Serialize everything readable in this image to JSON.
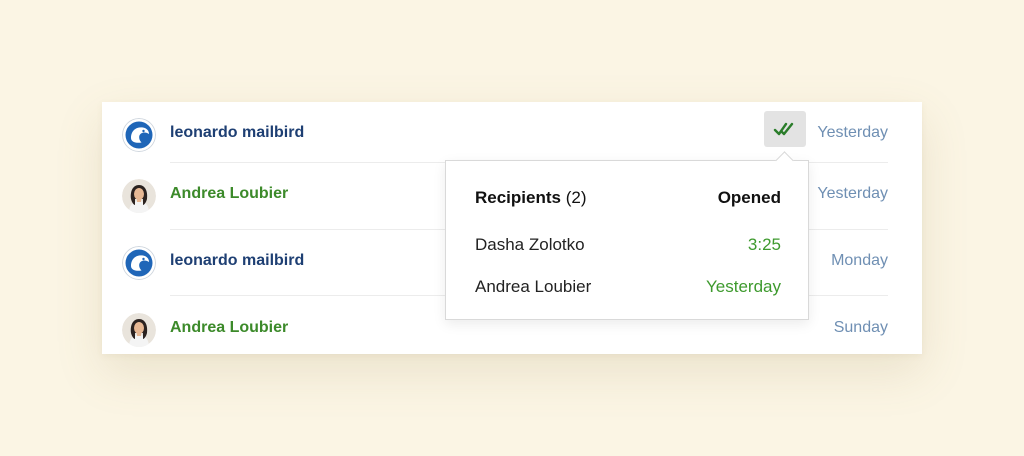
{
  "colors": {
    "background": "#fbf5e4",
    "sender_blue": "#1e3f73",
    "sender_green": "#3c8a2a",
    "date_color": "#6f8fb3",
    "opened_green": "#3e9a2e"
  },
  "messages": [
    {
      "sender": "leonardo mailbird",
      "date": "Yesterday",
      "avatar": "mailbird-logo-icon"
    },
    {
      "sender": "Andrea Loubier",
      "date": "Yesterday",
      "avatar": "user-photo"
    },
    {
      "sender": "leonardo mailbird",
      "date": "Monday",
      "avatar": "mailbird-logo-icon"
    },
    {
      "sender": "Andrea Loubier",
      "date": "Sunday",
      "avatar": "user-photo"
    }
  ],
  "read_receipt": {
    "icon": "double-check-icon",
    "popover": {
      "recipients_label": "Recipients",
      "recipients_count": "(2)",
      "opened_label": "Opened",
      "recipients": [
        {
          "name": "Dasha Zolotko",
          "opened": "3:25"
        },
        {
          "name": "Andrea Loubier",
          "opened": "Yesterday"
        }
      ]
    }
  }
}
